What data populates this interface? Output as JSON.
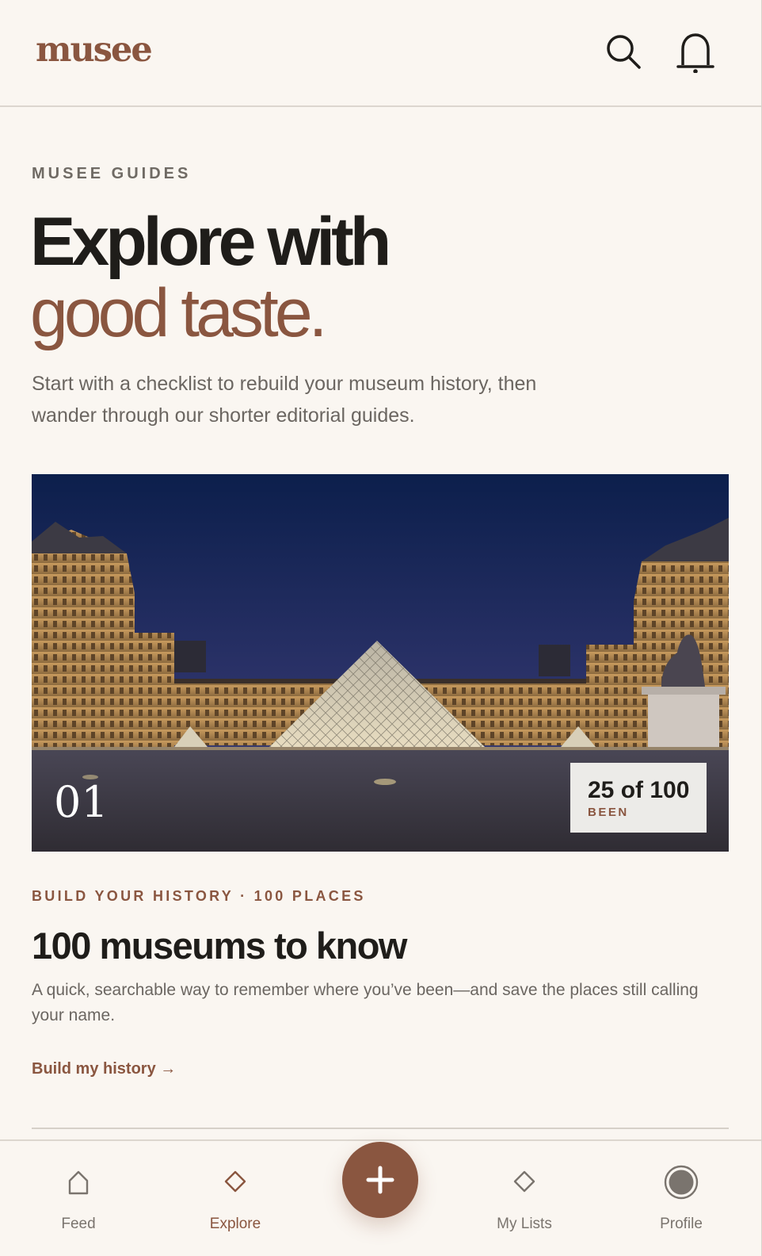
{
  "header": {
    "logo": "musee",
    "search_icon": "search-icon",
    "notifications_icon": "bell-icon"
  },
  "hero": {
    "eyebrow": "MUSEE GUIDES",
    "title_line1": "Explore with",
    "title_line2": "good taste.",
    "description": "Start with a checklist to rebuild your museum history, then wander through our shorter editorial guides."
  },
  "card": {
    "number": "01",
    "progress": {
      "count": "25 of 100",
      "label": "BEEN",
      "visited": 25,
      "total": 100
    },
    "kicker": "BUILD YOUR HISTORY · 100 PLACES",
    "title": "100 museums to know",
    "description": "A quick, searchable way to remember where you’ve been—and save the places still calling your name.",
    "link": "Build my history →"
  },
  "nav": {
    "items": [
      {
        "label": "Feed",
        "icon": "home-icon",
        "active": false
      },
      {
        "label": "Explore",
        "icon": "diamond-icon",
        "active": true
      },
      {
        "label": "My Lists",
        "icon": "diamond-icon",
        "active": false
      },
      {
        "label": "Profile",
        "icon": "profile-icon",
        "active": false
      }
    ],
    "fab_icon": "plus-icon"
  },
  "colors": {
    "background": "#faf6f1",
    "accent": "#8a5640",
    "text": "#1f1d1a",
    "muted": "#6b6661"
  }
}
